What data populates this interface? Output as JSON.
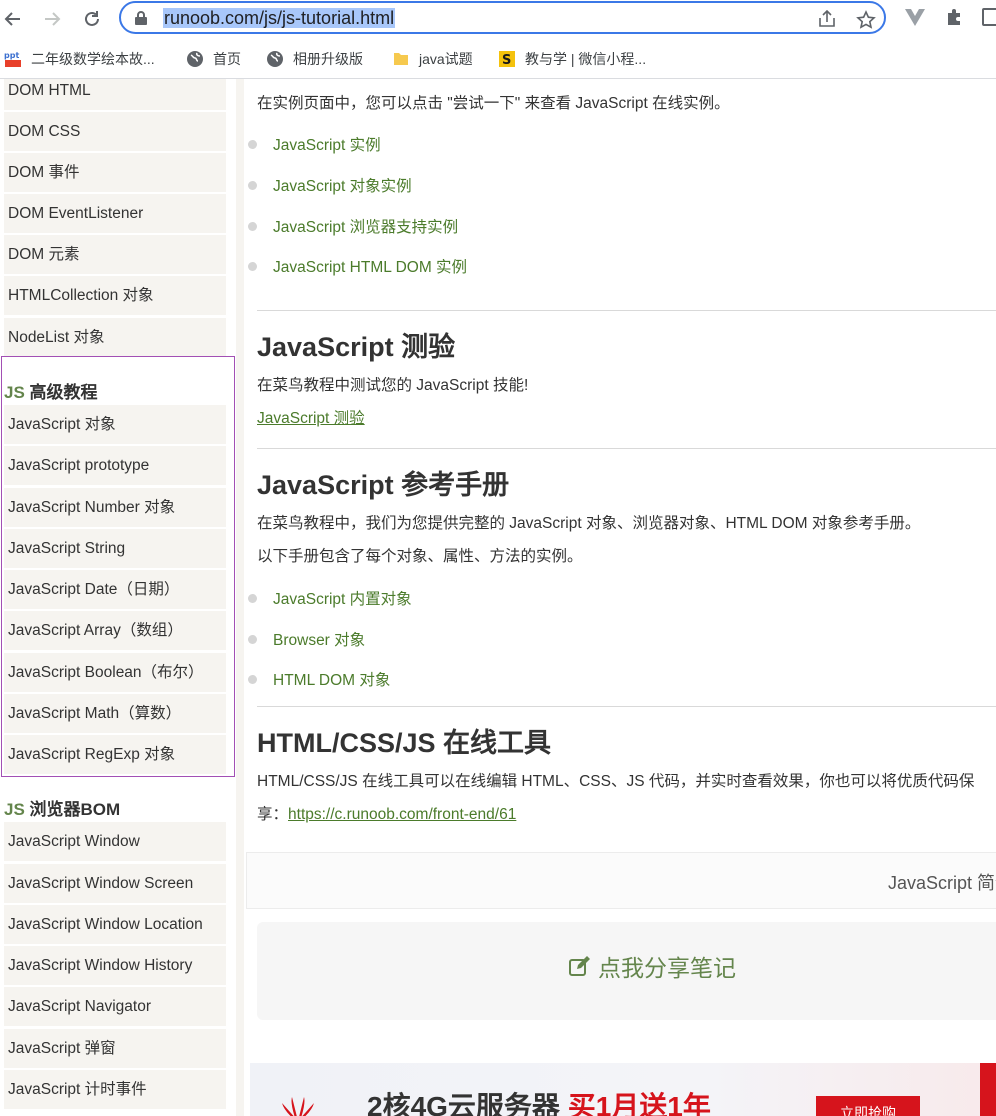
{
  "browser": {
    "url_text": "runoob.com/js/js-tutorial.html",
    "bookmarks": [
      {
        "label": "二年级数学绘本故...",
        "icon": "ppt-logo-icon"
      },
      {
        "label": "首页",
        "icon": "globe-icon"
      },
      {
        "label": "相册升级版",
        "icon": "globe-icon"
      },
      {
        "label": "java试题",
        "icon": "folder-icon"
      },
      {
        "label": "教与学 | 微信小程...",
        "icon": "s-logo-icon"
      }
    ]
  },
  "sidebar": {
    "top_items": [
      "DOM HTML",
      "DOM CSS",
      "DOM 事件",
      "DOM EventListener",
      "DOM 元素",
      "HTMLCollection 对象",
      "NodeList 对象"
    ],
    "advanced": {
      "prefix": "JS",
      "title": "高级教程",
      "items": [
        "JavaScript 对象",
        "JavaScript prototype",
        "JavaScript Number 对象",
        "JavaScript String",
        "JavaScript Date（日期）",
        "JavaScript Array（数组）",
        "JavaScript Boolean（布尔）",
        "JavaScript Math（算数）",
        "JavaScript RegExp 对象"
      ]
    },
    "bom": {
      "prefix": "JS",
      "title": "浏览器BOM",
      "items": [
        "JavaScript Window",
        "JavaScript Window Screen",
        "JavaScript Window Location",
        "JavaScript Window History",
        "JavaScript Navigator",
        "JavaScript 弹窗",
        "JavaScript 计时事件"
      ]
    }
  },
  "main": {
    "intro": "在实例页面中，您可以点击 \"尝试一下\" 来查看 JavaScript 在线实例。",
    "example_links": [
      "JavaScript 实例",
      "JavaScript 对象实例",
      "JavaScript 浏览器支持实例",
      "JavaScript HTML DOM 实例"
    ],
    "quiz": {
      "heading": "JavaScript 测验",
      "text": "在菜鸟教程中测试您的 JavaScript 技能!",
      "link": "JavaScript 测验"
    },
    "reference": {
      "heading": "JavaScript 参考手册",
      "text1": "在菜鸟教程中，我们为您提供完整的 JavaScript 对象、浏览器对象、HTML DOM 对象参考手册。",
      "text2": "以下手册包含了每个对象、属性、方法的实例。",
      "links": [
        "JavaScript 内置对象",
        "Browser 对象",
        "HTML DOM 对象"
      ]
    },
    "tools": {
      "heading": "HTML/CSS/JS 在线工具",
      "text1": "HTML/CSS/JS 在线工具可以在线编辑 HTML、CSS、JS 代码，并实时查看效果，你也可以将优质代码保",
      "text2_prefix": "享：",
      "link": "https://c.runoob.com/front-end/61"
    },
    "next_link": "JavaScript 简介",
    "share_note": "点我分享笔记",
    "ad": {
      "text_black": "2核4G云服务器 ",
      "text_red": "买1月送1年",
      "button": "立即抢购"
    }
  }
}
